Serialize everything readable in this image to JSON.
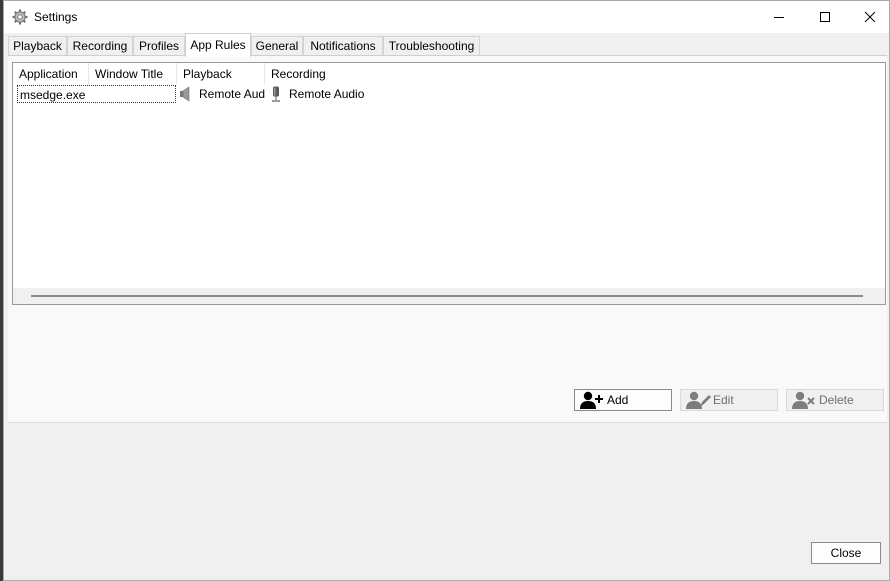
{
  "window": {
    "title": "Settings"
  },
  "tabs": [
    {
      "label": "Playback",
      "active": false
    },
    {
      "label": "Recording",
      "active": false
    },
    {
      "label": "Profiles",
      "active": false
    },
    {
      "label": "App Rules",
      "active": true
    },
    {
      "label": "General",
      "active": false
    },
    {
      "label": "Notifications",
      "active": false
    },
    {
      "label": "Troubleshooting",
      "active": false
    }
  ],
  "app_rules": {
    "columns": [
      "Application",
      "Window Title",
      "Playback",
      "Recording"
    ],
    "rows": [
      {
        "application": "msedge.exe",
        "window_title": "",
        "playback": "Remote Aud",
        "recording": "Remote Audio"
      }
    ]
  },
  "buttons": {
    "add": "Add",
    "edit": "Edit",
    "delete": "Delete",
    "close": "Close"
  },
  "colors": {
    "border": "#9a9a9a",
    "window_bg": "#f0f0f0"
  }
}
